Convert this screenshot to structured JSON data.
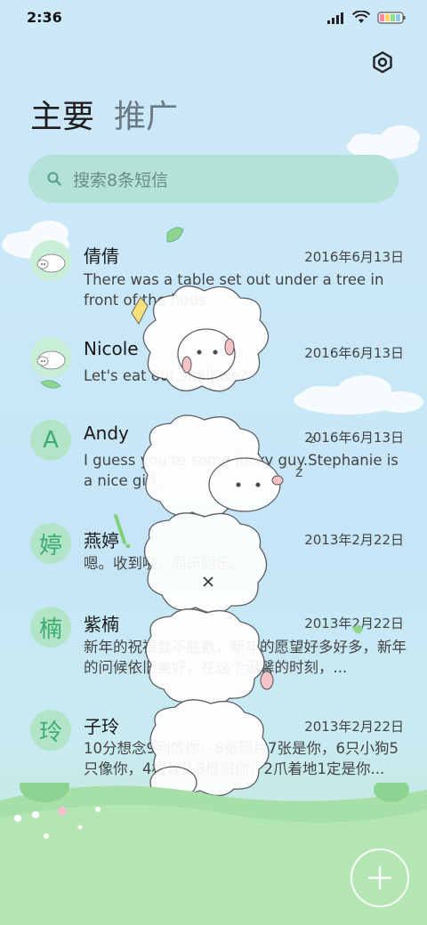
{
  "status_bar": {
    "time": "2:36"
  },
  "tabs": [
    {
      "label": "主要",
      "active": true
    },
    {
      "label": "推广",
      "active": false
    }
  ],
  "search": {
    "placeholder": "搜索8条短信"
  },
  "conversations": [
    {
      "name": "倩倩",
      "date": "2016年6月13日",
      "preview": "There was a table set out under a tree in front of the hous",
      "avatar_type": "sheep-image",
      "avatar_text": ""
    },
    {
      "name": "Nicole",
      "date": "2016年6月13日",
      "preview": "Let's eat out,shall we?",
      "avatar_type": "sheep-image",
      "avatar_text": ""
    },
    {
      "name": "Andy",
      "date": "2016年6月13日",
      "preview": "I guess you're some lucky guy.Stephanie is a nice girl.",
      "avatar_type": "letter",
      "avatar_text": "A"
    },
    {
      "name": "燕婷",
      "date": "2013年2月22日",
      "preview": "嗯。收到啦。同乐同乐。",
      "avatar_type": "letter",
      "avatar_text": "婷"
    },
    {
      "name": "紫楠",
      "date": "2013年2月22日",
      "preview": "新年的祝福数不胜数，新年的愿望好多好多，新年的问候依旧美好，在这个温馨的时刻，...",
      "avatar_type": "letter",
      "avatar_text": "楠"
    },
    {
      "name": "子玲",
      "date": "2013年2月22日",
      "preview": "10分想念9别的你，8张照片7张是你，6只小狗5只像你，4根骨头3根归你，2爪着地1定是你...",
      "avatar_type": "letter",
      "avatar_text": "玲"
    }
  ],
  "icons": {
    "settings": "gear-icon",
    "search": "search-icon",
    "compose": "plus-icon",
    "close_overlay": "close-icon"
  },
  "colors": {
    "accent": "#3dac6f",
    "search_bg": "#b4e2d8"
  }
}
